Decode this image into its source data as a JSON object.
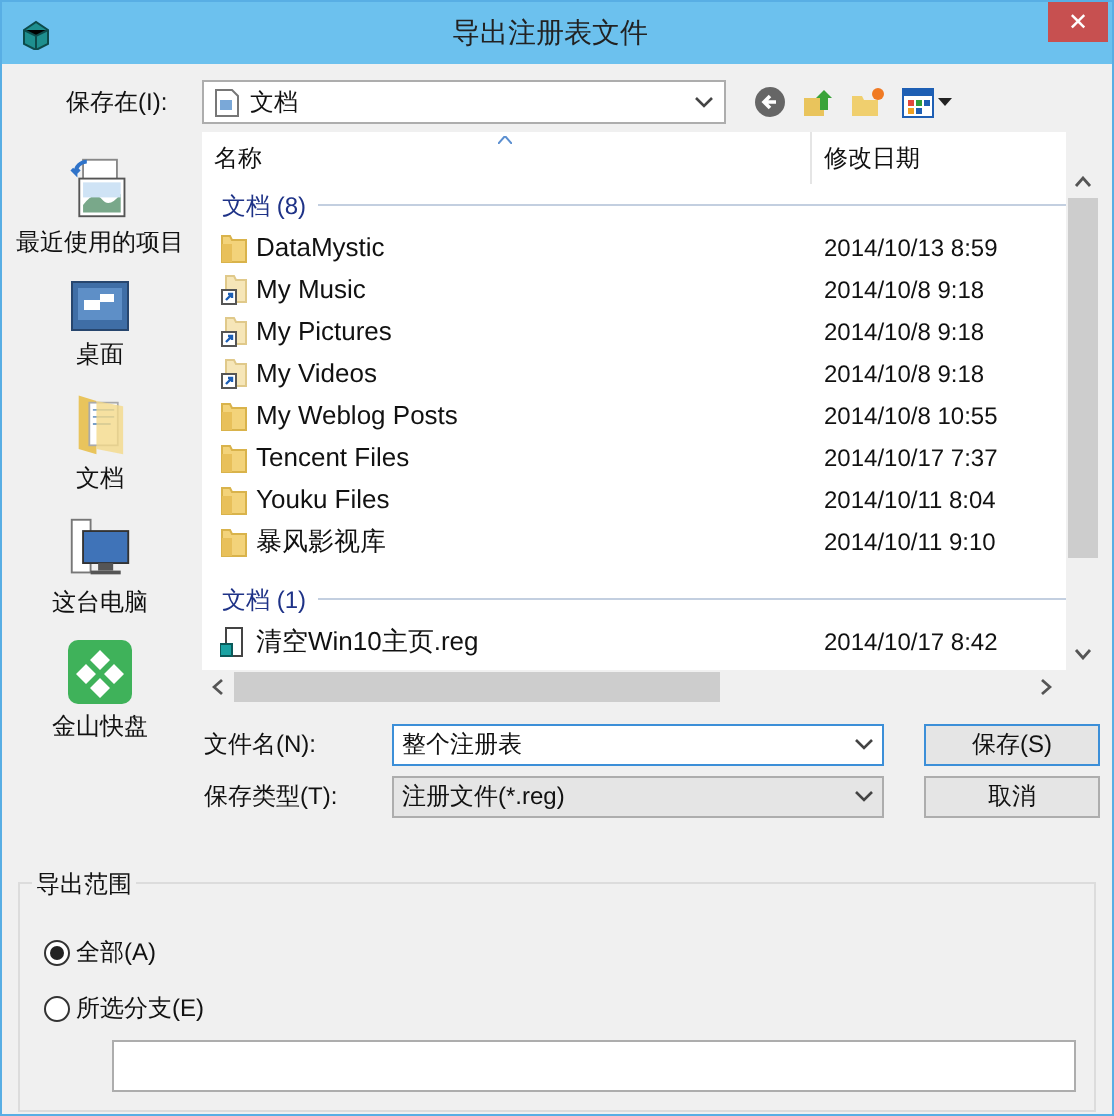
{
  "window": {
    "title": "导出注册表文件",
    "close_glyph": "✕"
  },
  "location": {
    "label": "保存在(I):",
    "value": "文档"
  },
  "sidebar": {
    "items": [
      {
        "kind": "recent",
        "label": "最近使用的项目"
      },
      {
        "kind": "desktop",
        "label": "桌面"
      },
      {
        "kind": "documents",
        "label": "文档"
      },
      {
        "kind": "computer",
        "label": "这台电脑"
      },
      {
        "kind": "app",
        "label": "金山快盘"
      }
    ]
  },
  "file_list": {
    "columns": [
      "名称",
      "修改日期"
    ],
    "groups": [
      {
        "title": "文档 (8)",
        "items": [
          {
            "kind": "folder",
            "name": "DataMystic",
            "date": "2014/10/13 8:59"
          },
          {
            "kind": "shortcut",
            "name": "My Music",
            "date": "2014/10/8 9:18"
          },
          {
            "kind": "shortcut",
            "name": "My Pictures",
            "date": "2014/10/8 9:18"
          },
          {
            "kind": "shortcut",
            "name": "My Videos",
            "date": "2014/10/8 9:18"
          },
          {
            "kind": "folder",
            "name": "My Weblog Posts",
            "date": "2014/10/8 10:55"
          },
          {
            "kind": "folder",
            "name": "Tencent Files",
            "date": "2014/10/17 7:37"
          },
          {
            "kind": "folder",
            "name": "Youku Files",
            "date": "2014/10/11 8:04"
          },
          {
            "kind": "folder",
            "name": "暴风影视库",
            "date": "2014/10/11 9:10"
          }
        ]
      },
      {
        "title": "文档 (1)",
        "items": [
          {
            "kind": "reg",
            "name": "清空Win10主页.reg",
            "date": "2014/10/17 8:42"
          }
        ]
      }
    ]
  },
  "filename": {
    "label": "文件名(N):",
    "value": "整个注册表"
  },
  "filetype": {
    "label": "保存类型(T):",
    "value": "注册文件(*.reg)"
  },
  "buttons": [
    "保存(S)",
    "取消"
  ],
  "export_range": {
    "title": "导出范围",
    "options": [
      {
        "label": "全部(A)",
        "selected": true
      },
      {
        "label": "所选分支(E)",
        "selected": false
      }
    ]
  }
}
